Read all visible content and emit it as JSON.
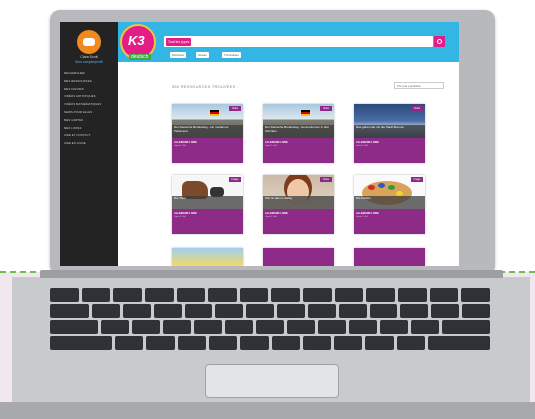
{
  "sidebar": {
    "user_name": "Clara Scott",
    "user_link": "Mon compte/profil",
    "items": [
      "RECHERCHER",
      "MES RESSOURCES",
      "MES FAVORIS",
      "VIDÉOS ARTISTIQUES",
      "VIDÉOS MATHÉMATIQUES",
      "NEWS POUR ELLES",
      "MES CARTES",
      "MES LISTES",
      "AIDE ET CONTACT",
      "AIDE EN LIGNE"
    ]
  },
  "header": {
    "logo_text": "K3",
    "logo_sub": "deutsch",
    "search_type": "Tout les types",
    "filters": [
      "Discipline",
      "Niveau",
      "Thématique"
    ]
  },
  "results": {
    "title": "550 RESSOURCES TROUVÉES :",
    "sort_label": "Trier par popularité"
  },
  "cards": [
    {
      "caption": "Der Deutsche Bundestag - ein modernes Parlament",
      "badge": "Vidéo",
      "publisher": "ALLEMAND LIVRE",
      "sub": "Cycle 3 - A1"
    },
    {
      "caption": "Der Deutsche Bundestag - Kennenlernen in drei Schritten",
      "badge": "Vidéo",
      "publisher": "ALLEMAND LIVRE",
      "sub": "Cycle 3 - A1"
    },
    {
      "caption": "Das gehen als mir die Stadt Bremen",
      "badge": "Vidéo",
      "publisher": "ALLEMAND LIVRE",
      "sub": "Cycle 3 - A1"
    },
    {
      "caption": "Die Tiere",
      "badge": "Image",
      "publisher": "ALLEMAND LIVRE",
      "sub": "Cycle 3 - A1"
    },
    {
      "caption": "Wie ist das im Alltag",
      "badge": "Vidéo",
      "publisher": "ALLEMAND LIVRE",
      "sub": "Cycle 3 - A1"
    },
    {
      "caption": "Die Farben",
      "badge": "Image",
      "publisher": "ALLEMAND LIVRE",
      "sub": "Cycle 3 - A1"
    }
  ],
  "colors": {
    "header": "#33b6e4",
    "accent": "#e21d85",
    "card_footer": "#8e2b88",
    "sidebar": "#232323",
    "page_background_bottom": "#f2e7ef",
    "dashed_line": "#6cc04a"
  }
}
